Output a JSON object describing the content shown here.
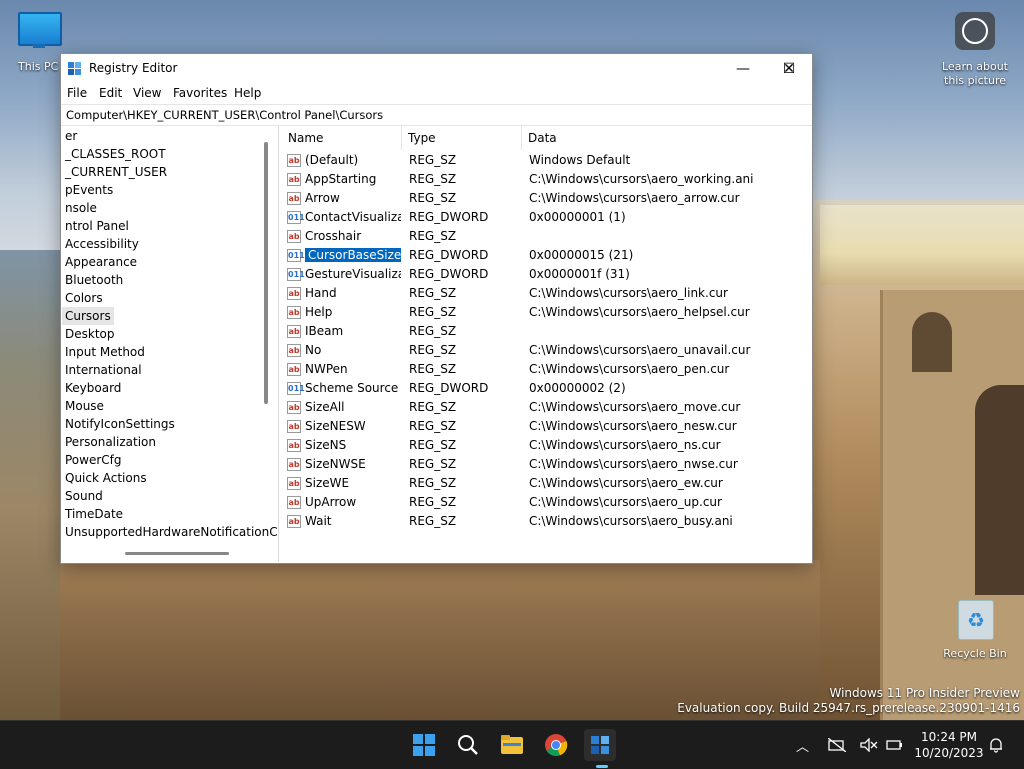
{
  "desktop": {
    "this_pc_label": "This PC",
    "learn_label": "Learn about this picture",
    "recycle_label": "Recycle Bin",
    "watermark_line1": "Windows 11 Pro Insider Preview",
    "watermark_line2": "Evaluation copy. Build 25947.rs_prerelease.230901-1416"
  },
  "window": {
    "title": "Registry Editor",
    "minimize_glyph": "—",
    "maximize_glyph": "☐",
    "close_glyph": "✕"
  },
  "menu": [
    "File",
    "Edit",
    "View",
    "Favorites",
    "Help"
  ],
  "address": "Computer\\HKEY_CURRENT_USER\\Control Panel\\Cursors",
  "tree": [
    "er",
    "_CLASSES_ROOT",
    "_CURRENT_USER",
    "pEvents",
    "nsole",
    "ntrol Panel",
    "Accessibility",
    "Appearance",
    "Bluetooth",
    "Colors",
    "Cursors",
    "Desktop",
    "Input Method",
    "International",
    "Keyboard",
    "Mouse",
    "NotifyIconSettings",
    "Personalization",
    "PowerCfg",
    "Quick Actions",
    "Sound",
    "TimeDate",
    "UnsupportedHardwareNotificationCa"
  ],
  "columns": {
    "name": "Name",
    "type": "Type",
    "data": "Data"
  },
  "values": [
    {
      "name": "(Default)",
      "type": "REG_SZ",
      "data": "Windows Default",
      "icon": "ab"
    },
    {
      "name": "AppStarting",
      "type": "REG_SZ",
      "data": "C:\\Windows\\cursors\\aero_working.ani",
      "icon": "ab"
    },
    {
      "name": "Arrow",
      "type": "REG_SZ",
      "data": "C:\\Windows\\cursors\\aero_arrow.cur",
      "icon": "ab"
    },
    {
      "name": "ContactVisualiza...",
      "type": "REG_DWORD",
      "data": "0x00000001 (1)",
      "icon": "011"
    },
    {
      "name": "Crosshair",
      "type": "REG_SZ",
      "data": "",
      "icon": "ab"
    },
    {
      "name": "CursorBaseSize",
      "type": "REG_DWORD",
      "data": "0x00000015 (21)",
      "icon": "011"
    },
    {
      "name": "GestureVisualiza...",
      "type": "REG_DWORD",
      "data": "0x0000001f (31)",
      "icon": "011"
    },
    {
      "name": "Hand",
      "type": "REG_SZ",
      "data": "C:\\Windows\\cursors\\aero_link.cur",
      "icon": "ab"
    },
    {
      "name": "Help",
      "type": "REG_SZ",
      "data": "C:\\Windows\\cursors\\aero_helpsel.cur",
      "icon": "ab"
    },
    {
      "name": "IBeam",
      "type": "REG_SZ",
      "data": "",
      "icon": "ab"
    },
    {
      "name": "No",
      "type": "REG_SZ",
      "data": "C:\\Windows\\cursors\\aero_unavail.cur",
      "icon": "ab"
    },
    {
      "name": "NWPen",
      "type": "REG_SZ",
      "data": "C:\\Windows\\cursors\\aero_pen.cur",
      "icon": "ab"
    },
    {
      "name": "Scheme Source",
      "type": "REG_DWORD",
      "data": "0x00000002 (2)",
      "icon": "011"
    },
    {
      "name": "SizeAll",
      "type": "REG_SZ",
      "data": "C:\\Windows\\cursors\\aero_move.cur",
      "icon": "ab"
    },
    {
      "name": "SizeNESW",
      "type": "REG_SZ",
      "data": "C:\\Windows\\cursors\\aero_nesw.cur",
      "icon": "ab"
    },
    {
      "name": "SizeNS",
      "type": "REG_SZ",
      "data": "C:\\Windows\\cursors\\aero_ns.cur",
      "icon": "ab"
    },
    {
      "name": "SizeNWSE",
      "type": "REG_SZ",
      "data": "C:\\Windows\\cursors\\aero_nwse.cur",
      "icon": "ab"
    },
    {
      "name": "SizeWE",
      "type": "REG_SZ",
      "data": "C:\\Windows\\cursors\\aero_ew.cur",
      "icon": "ab"
    },
    {
      "name": "UpArrow",
      "type": "REG_SZ",
      "data": "C:\\Windows\\cursors\\aero_up.cur",
      "icon": "ab"
    },
    {
      "name": "Wait",
      "type": "REG_SZ",
      "data": "C:\\Windows\\cursors\\aero_busy.ani",
      "icon": "ab"
    }
  ],
  "taskbar": {
    "time": "10:24 PM",
    "date": "10/20/2023",
    "icons": [
      "windows-start-icon",
      "search-icon",
      "file-explorer-icon",
      "chrome-icon",
      "registry-editor-icon"
    ]
  },
  "colors": {
    "selection": "#0067c0",
    "accent": "#60cdff",
    "taskbar": "#1c1c1c"
  }
}
